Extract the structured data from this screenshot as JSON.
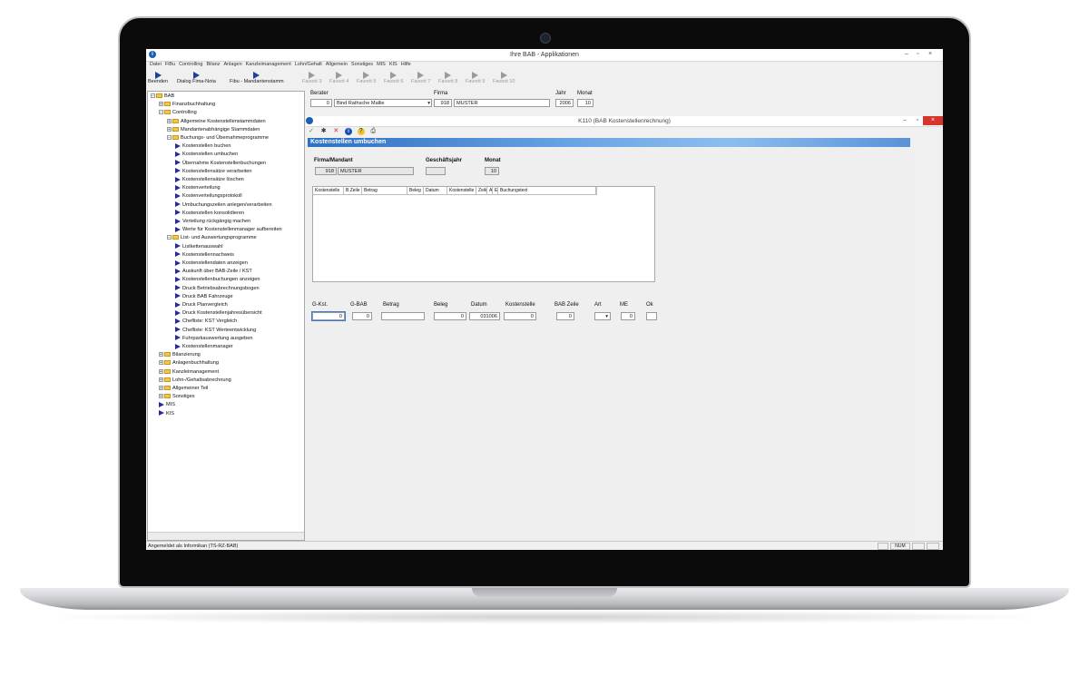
{
  "window": {
    "title": "Ihre BAB - Applikationen",
    "minimize": "–",
    "maximize": "▫",
    "close": "×"
  },
  "menu": [
    "Datei",
    "FiBu",
    "Controlling",
    "Bilanz",
    "Anlagen",
    "Kanzleimanagement",
    "Lohn/Gehalt",
    "Allgemein",
    "Sonstiges",
    "MIS",
    "KIS",
    "Hilfe"
  ],
  "toolbar": {
    "buttons": [
      "Beenden",
      "Dialog Fima-Nota",
      "Fibu - Mandantenstamm"
    ],
    "favorites": [
      "Favorit 3",
      "Favorit 4",
      "Favorit 5",
      "Favorit 6",
      "Favorit 7",
      "Favorit 8",
      "Favorit 9",
      "Favorit 10"
    ]
  },
  "fields": {
    "berater_label": "Berater",
    "berater_nr": "0",
    "berater_name": "Bind Rathsche Mallie",
    "firma_label": "Firma",
    "firma_nr": "918",
    "firma_name": "MUSTER",
    "jahr_label": "Jahr",
    "jahr_value": "2006",
    "monat_label": "Monat",
    "monat_value": "10"
  },
  "tree": [
    {
      "label": "BAB",
      "level": 0,
      "icon": "folder",
      "exp": "−"
    },
    {
      "label": "Finanzbuchhaltung",
      "level": 1,
      "icon": "folder",
      "exp": "+"
    },
    {
      "label": "Controlling",
      "level": 1,
      "icon": "folder",
      "exp": "−"
    },
    {
      "label": "Allgemeine Kostenstellenstammdaten",
      "level": 2,
      "icon": "folder",
      "exp": "+"
    },
    {
      "label": "Mandantenabhängige Stammdaten",
      "level": 2,
      "icon": "folder",
      "exp": "+"
    },
    {
      "label": "Buchungs- und Übernahmeprogramme",
      "level": 2,
      "icon": "folder",
      "exp": "−"
    },
    {
      "label": "Kostenstellen buchen",
      "level": 3,
      "icon": "arrow"
    },
    {
      "label": "Kostenstellen umbuchen",
      "level": 3,
      "icon": "arrow"
    },
    {
      "label": "Übernahme Kostenstellenbuchungen",
      "level": 3,
      "icon": "arrow"
    },
    {
      "label": "Kostenstellensätze verarbeiten",
      "level": 3,
      "icon": "arrow"
    },
    {
      "label": "Kostenstellensätze löschen",
      "level": 3,
      "icon": "arrow"
    },
    {
      "label": "Kostenverteilung",
      "level": 3,
      "icon": "arrow"
    },
    {
      "label": "Kostenverteilungsprotokoll",
      "level": 3,
      "icon": "arrow"
    },
    {
      "label": "Umbuchungszeilen anlegen/verarbeiten",
      "level": 3,
      "icon": "arrow"
    },
    {
      "label": "Kostenstellen konsolidieren",
      "level": 3,
      "icon": "arrow"
    },
    {
      "label": "Verteilung rückgängig machen",
      "level": 3,
      "icon": "arrow"
    },
    {
      "label": "Werte für Kostenstellenmanager aufbereiten",
      "level": 3,
      "icon": "arrow"
    },
    {
      "label": "List- und Auswertungsprogramme",
      "level": 2,
      "icon": "folder",
      "exp": "−"
    },
    {
      "label": "Listkettenauswahl",
      "level": 3,
      "icon": "arrow"
    },
    {
      "label": "Kostenstellennachweis",
      "level": 3,
      "icon": "arrow"
    },
    {
      "label": "Kostenstellendaten anzeigen",
      "level": 3,
      "icon": "arrow"
    },
    {
      "label": "Auskunft über BAB-Zeile / KST",
      "level": 3,
      "icon": "arrow"
    },
    {
      "label": "Kostenstellenbuchungen anzeigen",
      "level": 3,
      "icon": "arrow"
    },
    {
      "label": "Druck Betriebsabrechnungsbogen",
      "level": 3,
      "icon": "arrow"
    },
    {
      "label": "Druck BAB Fahrzeuge",
      "level": 3,
      "icon": "arrow"
    },
    {
      "label": "Druck Planvergleich",
      "level": 3,
      "icon": "arrow"
    },
    {
      "label": "Druck Kostenstellenjahresübersicht",
      "level": 3,
      "icon": "arrow"
    },
    {
      "label": "Chefliste: KST Vergleich",
      "level": 3,
      "icon": "arrow"
    },
    {
      "label": "Chefliste: KST Werteentwicklung",
      "level": 3,
      "icon": "arrow"
    },
    {
      "label": "Fuhrparkauswertung ausgeben",
      "level": 3,
      "icon": "arrow"
    },
    {
      "label": "Kostenstellenmanager",
      "level": 3,
      "icon": "arrow"
    },
    {
      "label": "Bilanzierung",
      "level": 1,
      "icon": "folder",
      "exp": "+"
    },
    {
      "label": "Anlagenbuchhaltung",
      "level": 1,
      "icon": "folder",
      "exp": "+"
    },
    {
      "label": "Kanzleimanagement",
      "level": 1,
      "icon": "folder",
      "exp": "+"
    },
    {
      "label": "Lohn-/Gehaltsabrechnung",
      "level": 1,
      "icon": "folder",
      "exp": "+"
    },
    {
      "label": "Allgemeiner Teil",
      "level": 1,
      "icon": "folder",
      "exp": "+"
    },
    {
      "label": "Sonstiges",
      "level": 1,
      "icon": "folder",
      "exp": "+"
    },
    {
      "label": "MIS",
      "level": 1,
      "icon": "arrow"
    },
    {
      "label": "KIS",
      "level": 1,
      "icon": "arrow"
    }
  ],
  "inner": {
    "title": "K110 (BAB Kostenstellenrechnung)",
    "banner": "Kostenstellen umbuchen",
    "firma_label": "Firma/Mandant",
    "firma_nr": "918",
    "firma_name": "MUSTER",
    "gj_label": "Geschäftsjahr",
    "gj_value": "",
    "monat_label": "Monat",
    "monat_value": "10",
    "grid_headers": [
      "Kostenstelle",
      "B.Zeile",
      "Betrag",
      "Beleg",
      "Datum",
      "Kostenstelle",
      "Zeile",
      "A",
      "E",
      "Buchungstext"
    ],
    "entry_labels": [
      "G-Kst.",
      "G-BAB",
      "Betrag",
      "Beleg",
      "Datum",
      "Kostenstelle",
      "BAB Zeile",
      "Art",
      "ME",
      "Ok"
    ],
    "entry_values": [
      "0",
      "0",
      "",
      "0",
      "031006",
      "0",
      "0",
      "",
      "0",
      ""
    ]
  },
  "status": {
    "message": "Angemeldet als Informikan (TS-RZ-BAB)",
    "num": "NUM"
  },
  "colors": {
    "banner_start": "#2d6fc2",
    "banner_end": "#8cbdef",
    "close_button": "#d9342b"
  }
}
